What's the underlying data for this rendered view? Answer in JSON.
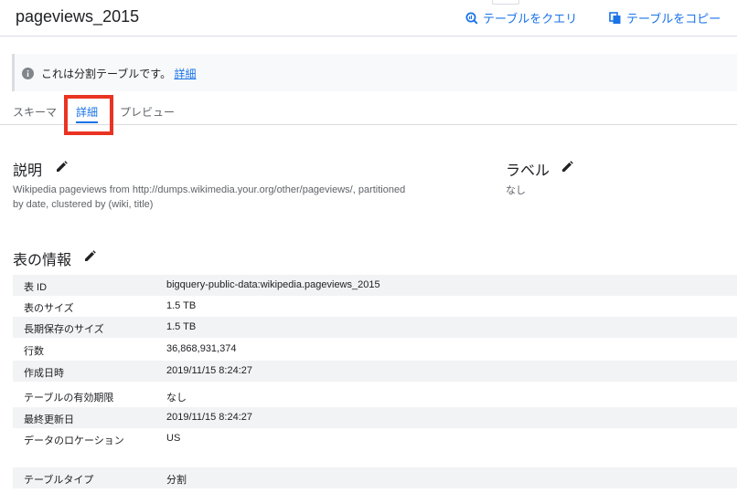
{
  "header": {
    "title": "pageviews_2015",
    "actions": [
      {
        "label": "テーブルをクエリ",
        "icon": "query-icon"
      },
      {
        "label": "テーブルをコピー",
        "icon": "copy-icon"
      }
    ]
  },
  "banner": {
    "icon": "info-icon",
    "text": "これは分割テーブルです。",
    "link": "詳細"
  },
  "tabs": [
    {
      "label": "スキーマ",
      "active": false
    },
    {
      "label": "詳細",
      "active": true
    },
    {
      "label": "プレビュー",
      "active": false
    }
  ],
  "description": {
    "heading": "説明",
    "text": "Wikipedia pageviews from http://dumps.wikimedia.your.org/other/pageviews/, partitioned by date, clustered by (wiki, title)"
  },
  "labels": {
    "heading": "ラベル",
    "value": "なし"
  },
  "table_info": {
    "heading": "表の情報",
    "rows": [
      {
        "key": "表 ID",
        "value": "bigquery-public-data:wikipedia.pageviews_2015"
      },
      {
        "key": "表のサイズ",
        "value": "1.5 TB"
      },
      {
        "key": "長期保存のサイズ",
        "value": "1.5 TB"
      },
      {
        "key": "行数",
        "value": "36,868,931,374"
      },
      {
        "key": "作成日時",
        "value": "2019/11/15 8:24:27"
      },
      {
        "key": "テーブルの有効期限",
        "value": "なし"
      },
      {
        "key": "最終更新日",
        "value": "2019/11/15 8:24:27"
      },
      {
        "key": "データのロケーション",
        "value": "US"
      },
      {
        "key": "テーブルタイプ",
        "value": "分割"
      }
    ]
  },
  "colors": {
    "accent": "#1a73e8",
    "highlight": "#ea3323",
    "row_shade": "#f1f3f4"
  }
}
